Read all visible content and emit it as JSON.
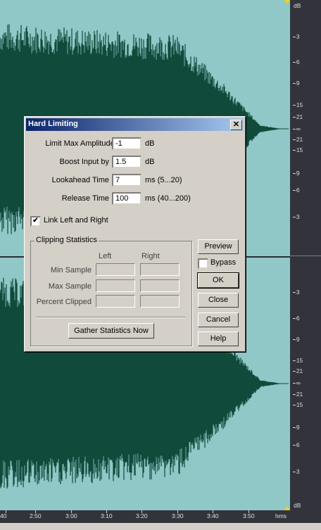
{
  "dialog": {
    "title": "Hard Limiting",
    "close_symbol": "✕",
    "fields": [
      {
        "label": "Limit Max Amplitude to",
        "value": "-1",
        "unit": "dB"
      },
      {
        "label": "Boost Input by",
        "value": "1.5",
        "unit": "dB"
      },
      {
        "label": "Lookahead Time",
        "value": "7",
        "unit": "ms (5...20)"
      },
      {
        "label": "Release Time",
        "value": "100",
        "unit": "ms (40...200)"
      }
    ],
    "link_checkbox": {
      "label": "Link Left and Right",
      "checked": true,
      "mark": "✔"
    },
    "clipping": {
      "title": "Clipping Statistics",
      "col_left": "Left",
      "col_right": "Right",
      "rows": [
        "Min Sample",
        "Max Sample",
        "Percent Clipped"
      ],
      "gather_label": "Gather Statistics Now"
    },
    "buttons": {
      "preview": "Preview",
      "bypass": "Bypass",
      "bypass_checked": false,
      "ok": "OK",
      "close": "Close",
      "cancel": "Cancel",
      "help": "Help"
    }
  },
  "scale": {
    "unit_top": "dB",
    "unit_bottom": "dB",
    "channel1_ticks": [
      "-3",
      "-6",
      "-9",
      "-15",
      "-21",
      "-∞",
      "-21",
      "-15",
      "-9",
      "-6",
      "-3"
    ],
    "channel2_ticks": [
      "-3",
      "-6",
      "-9",
      "-15",
      "-21",
      "-∞",
      "-21",
      "-15",
      "-9",
      "-6",
      "-3"
    ]
  },
  "timeline": {
    "labels": [
      "40",
      "2:50",
      "3:00",
      "3:10",
      "3:20",
      "3:30",
      "3:40",
      "3:50"
    ],
    "unit": "hms"
  },
  "colors": {
    "waveform": "#0f4a3a",
    "background": "#90c8c8",
    "scale_bg": "#33333c",
    "title_bar": "#0a246a",
    "marker": "#f0d020"
  }
}
